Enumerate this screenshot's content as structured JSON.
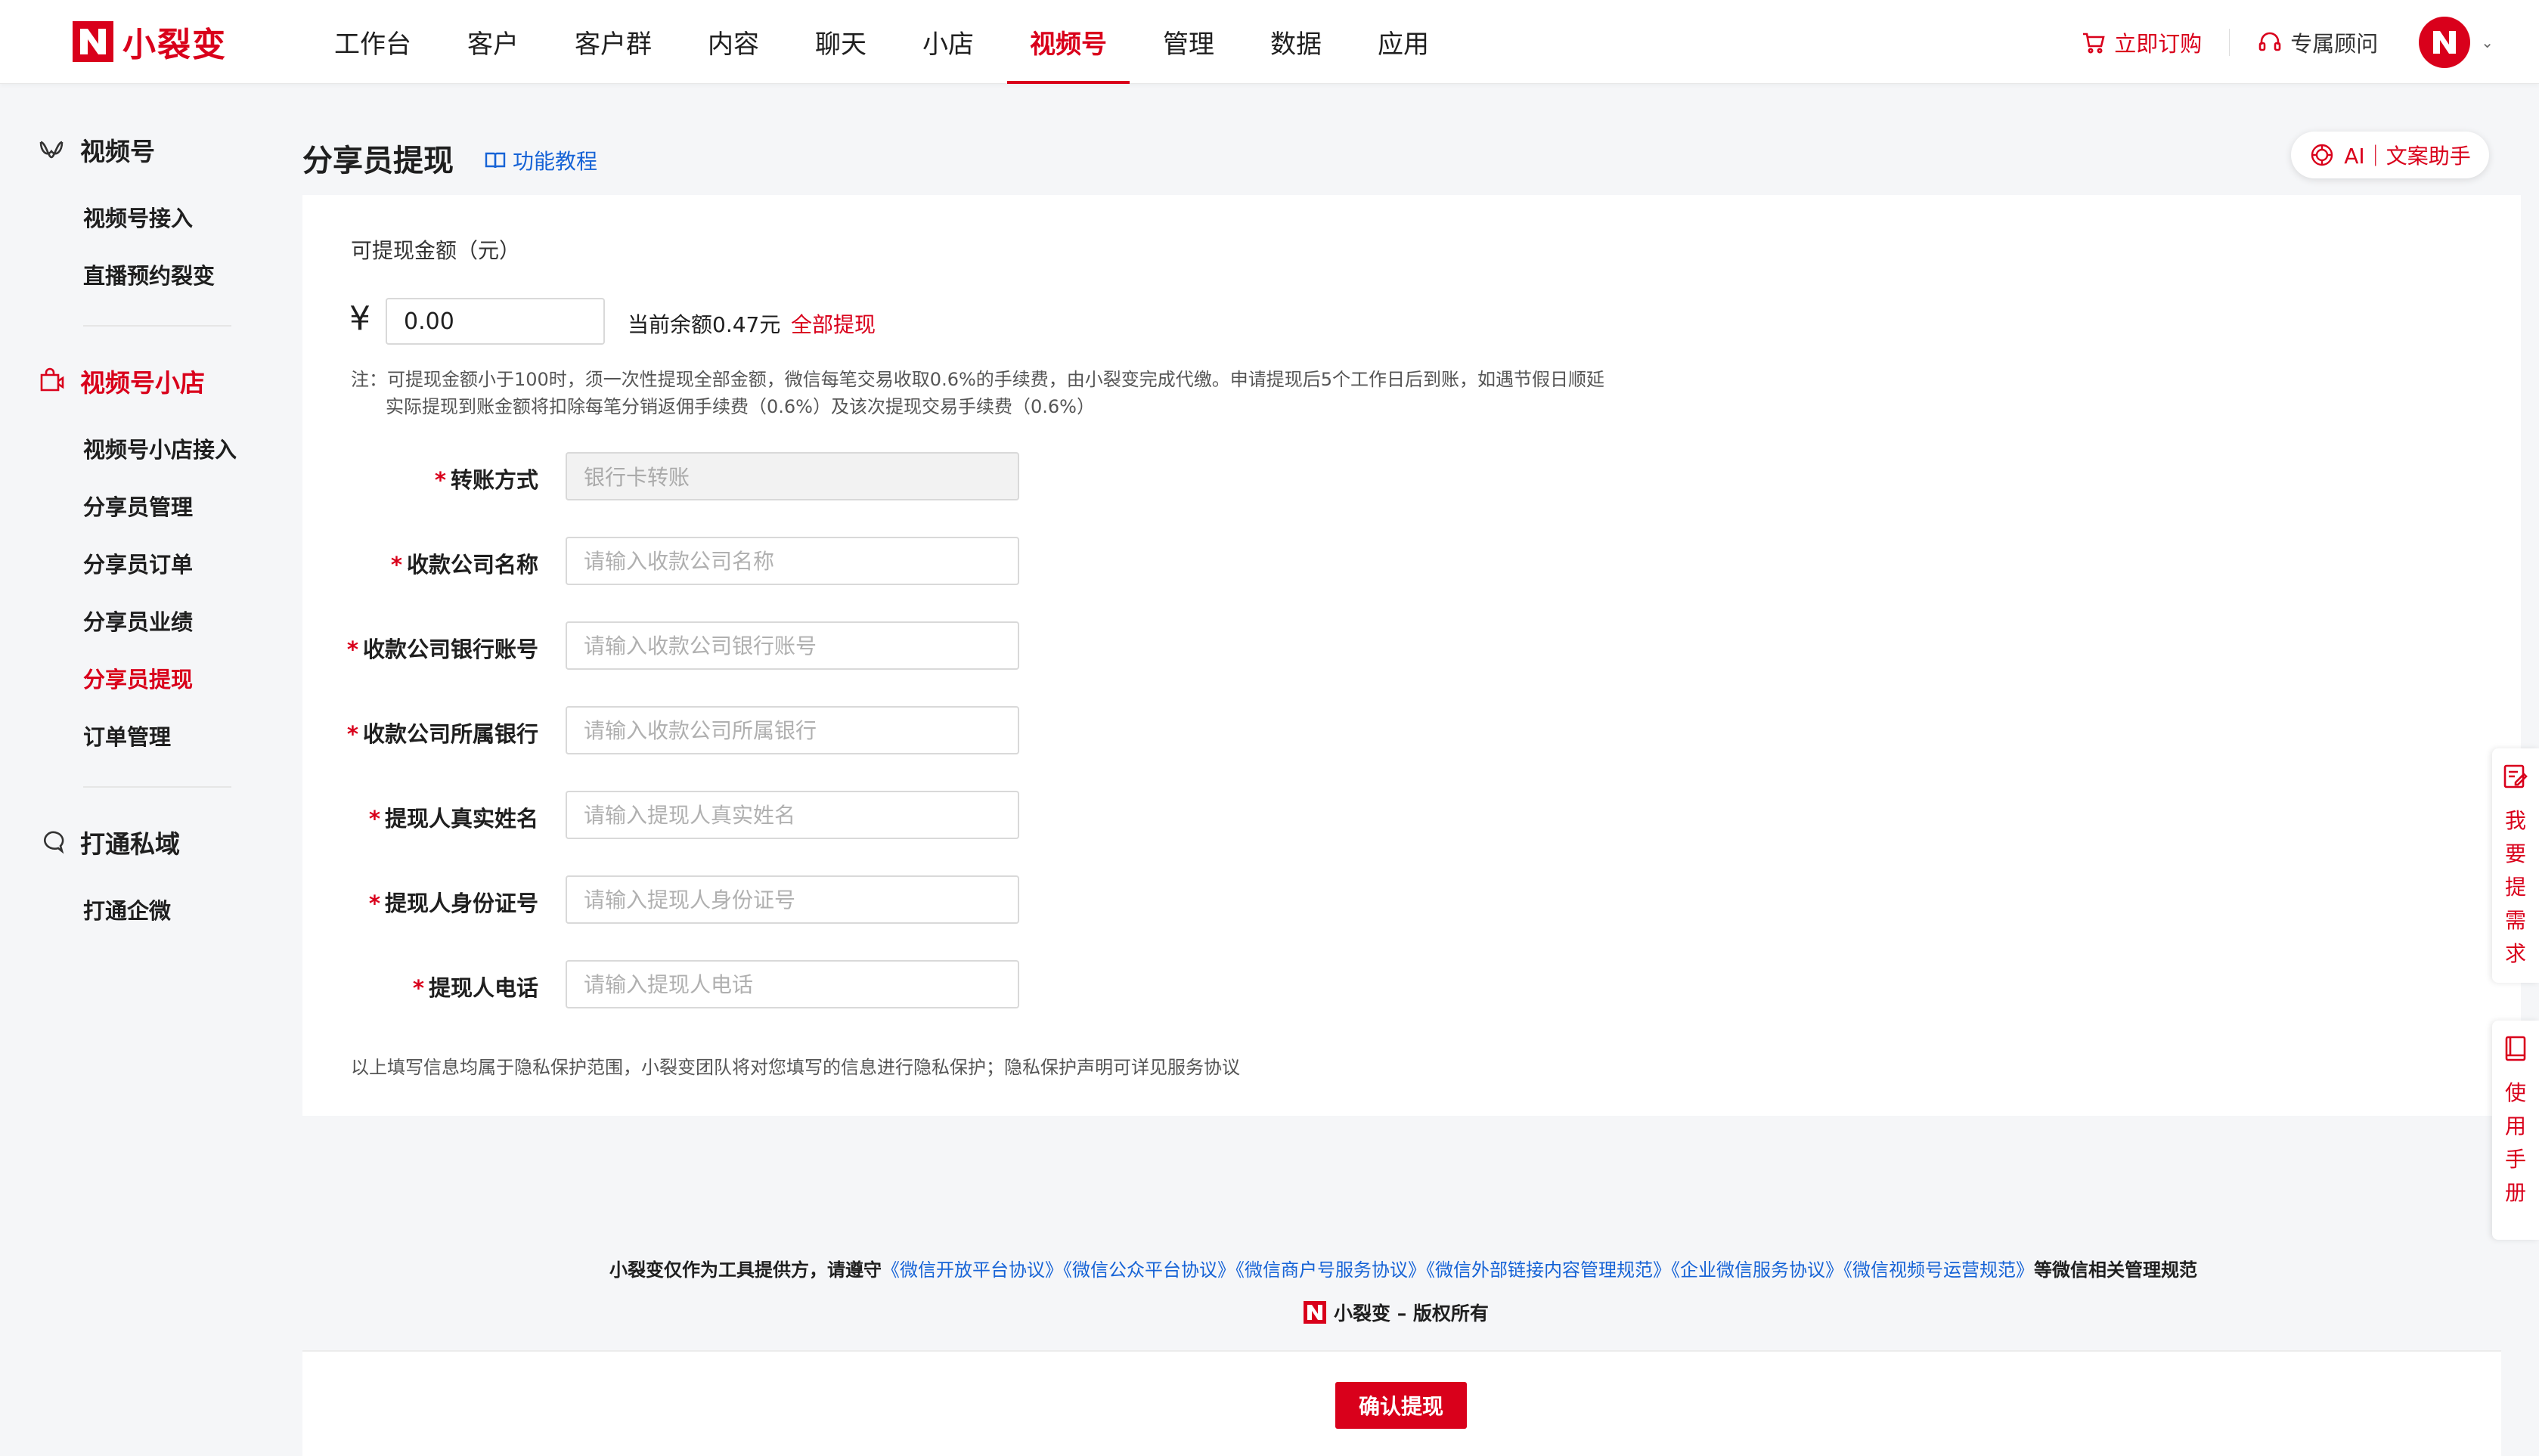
{
  "brand": {
    "name": "小裂变",
    "accent": "#d9001b",
    "link": "#1663d6"
  },
  "nav": {
    "items": [
      "工作台",
      "客户",
      "客户群",
      "内容",
      "聊天",
      "小店",
      "视频号",
      "管理",
      "数据",
      "应用"
    ],
    "active_index": 6
  },
  "header": {
    "order_label": "立即订购",
    "consultant_label": "专属顾问"
  },
  "sidebar": {
    "groups": [
      {
        "title": "视频号",
        "icon": "video-channel-icon",
        "items": [
          "视频号接入",
          "直播预约裂变"
        ]
      },
      {
        "title": "视频号小店",
        "icon": "shop-icon",
        "items": [
          "视频号小店接入",
          "分享员管理",
          "分享员订单",
          "分享员业绩",
          "分享员提现",
          "订单管理"
        ]
      },
      {
        "title": "打通私域",
        "icon": "chat-icon",
        "items": [
          "打通企微"
        ]
      }
    ],
    "active_item": "分享员提现"
  },
  "page": {
    "title": "分享员提现",
    "tutorial_label": "功能教程",
    "ai_label": "AI｜文案助手"
  },
  "withdraw": {
    "amount_label": "可提现金额（元）",
    "currency_symbol": "¥",
    "amount_value": "0.00",
    "balance_text": "当前余额0.47元",
    "withdraw_all_label": "全部提现",
    "note_line1": "注：可提现金额小于100时，须一次性提现全部金额，微信每笔交易收取0.6%的手续费，由小裂变完成代缴。申请提现后5个工作日后到账，如遇节假日顺延",
    "note_line2": "实际提现到账金额将扣除每笔分销返佣手续费（0.6%）及该次提现交易手续费（0.6%）"
  },
  "form": {
    "fields": [
      {
        "label": "转账方式",
        "placeholder": "",
        "value": "银行卡转账",
        "disabled": true
      },
      {
        "label": "收款公司名称",
        "placeholder": "请输入收款公司名称",
        "value": ""
      },
      {
        "label": "收款公司银行账号",
        "placeholder": "请输入收款公司银行账号",
        "value": ""
      },
      {
        "label": "收款公司所属银行",
        "placeholder": "请输入收款公司所属银行",
        "value": ""
      },
      {
        "label": "提现人真实姓名",
        "placeholder": "请输入提现人真实姓名",
        "value": ""
      },
      {
        "label": "提现人身份证号",
        "placeholder": "请输入提现人身份证号",
        "value": ""
      },
      {
        "label": "提现人电话",
        "placeholder": "请输入提现人电话",
        "value": ""
      }
    ],
    "privacy_note": "以上填写信息均属于隐私保护范围，小裂变团队将对您填写的信息进行隐私保护；隐私保护声明可详见服务协议"
  },
  "footer": {
    "prefix": "小裂变仅作为工具提供方，请遵守",
    "links": [
      "《微信开放平台协议》",
      "《微信公众平台协议》",
      "《微信商户号服务协议》",
      "《微信外部链接内容管理规范》",
      "《企业微信服务协议》",
      "《微信视频号运营规范》"
    ],
    "suffix": "等微信相关管理规范",
    "copyright": "小裂变 – 版权所有"
  },
  "actions": {
    "confirm_label": "确认提现"
  },
  "float": {
    "request_label": "我要提需求",
    "manual_label": "使用手册"
  }
}
